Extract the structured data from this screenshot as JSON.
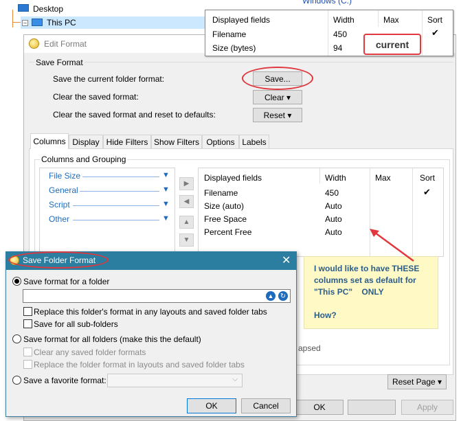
{
  "tree": {
    "desktop": "Desktop",
    "this_pc": "This PC",
    "windows_c": "Windows (C:)"
  },
  "edit_format": {
    "title": "Edit Format",
    "save_format_group": "Save Format",
    "rows": [
      {
        "label": "Save the current folder format:",
        "button": "Save..."
      },
      {
        "label": "Clear the saved format:",
        "button": "Clear ▾"
      },
      {
        "label": "Clear the saved format and reset to defaults:",
        "button": "Reset ▾"
      }
    ],
    "tabs": [
      "Columns",
      "Display",
      "Hide Filters",
      "Show Filters",
      "Options",
      "Labels"
    ],
    "columns_group": "Columns and Grouping",
    "categories": [
      "File Size",
      "General",
      "Script",
      "Other"
    ],
    "grid_headers": [
      "Displayed fields",
      "Width",
      "Max",
      "Sort"
    ],
    "grid_rows": [
      {
        "field": "Filename",
        "width": "450",
        "max": "",
        "sort": "✔"
      },
      {
        "field": "Size (auto)",
        "width": "Auto",
        "max": "",
        "sort": ""
      },
      {
        "field": "Free Space",
        "width": "Auto",
        "max": "",
        "sort": ""
      },
      {
        "field": "Percent Free",
        "width": "Auto",
        "max": "",
        "sort": ""
      }
    ],
    "partial_text": "apsed",
    "reset_page": "Reset Page ▾",
    "ok": "OK",
    "apply": "Apply"
  },
  "overlay_table": {
    "headers": [
      "Displayed fields",
      "Width",
      "Max",
      "Sort"
    ],
    "rows": [
      {
        "field": "Filename",
        "width": "450",
        "sort": "✔"
      },
      {
        "field": "Size (bytes)",
        "width": "94",
        "sort": ""
      }
    ],
    "label": "current"
  },
  "note": {
    "lines": [
      "I would like to have THESE",
      "columns set as default for",
      "\"This PC\"    ONLY",
      "",
      "How?"
    ]
  },
  "save_folder_dialog": {
    "title": "Save Folder Format",
    "opt_folder": "Save format for a folder",
    "path_value": "",
    "chk_replace": "Replace this folder's format in any layouts and saved folder tabs",
    "chk_subfolders": "Save for all sub-folders",
    "opt_all": "Save format for all folders (make this the default)",
    "chk_clear_saved": "Clear any saved folder formats",
    "chk_replace_layouts": "Replace the folder format in layouts and saved folder tabs",
    "opt_favorite": "Save a favorite format:",
    "favorite_value": "",
    "ok": "OK",
    "cancel": "Cancel"
  },
  "colors": {
    "annotation_red": "#e0383e",
    "dialog_title_bg": "#2b7ea0",
    "note_bg": "#fff9c6",
    "note_text": "#2b5d8a"
  }
}
